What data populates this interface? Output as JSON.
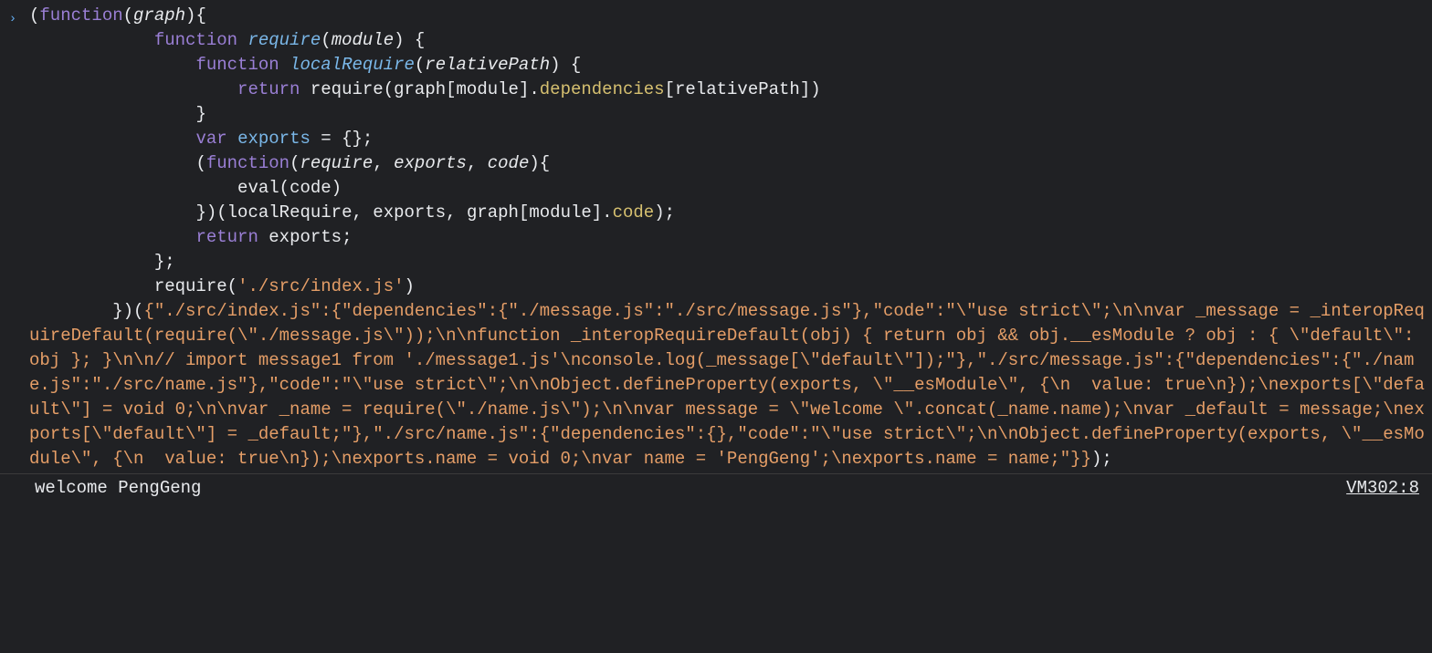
{
  "console": {
    "prompt_glyph": "›",
    "log_output": "welcome PengGeng",
    "source_link": "VM302:8",
    "tokens": [
      {
        "t": "punc",
        "v": "("
      },
      {
        "t": "keyword",
        "v": "function"
      },
      {
        "t": "punc",
        "v": "("
      },
      {
        "t": "param",
        "v": "graph"
      },
      {
        "t": "punc",
        "v": "){"
      },
      {
        "t": "nl",
        "v": "\n"
      },
      {
        "t": "plain",
        "v": "            "
      },
      {
        "t": "keyword",
        "v": "function"
      },
      {
        "t": "plain",
        "v": " "
      },
      {
        "t": "def",
        "v": "require"
      },
      {
        "t": "punc",
        "v": "("
      },
      {
        "t": "param",
        "v": "module"
      },
      {
        "t": "punc",
        "v": ") {"
      },
      {
        "t": "nl",
        "v": "\n"
      },
      {
        "t": "plain",
        "v": "                "
      },
      {
        "t": "keyword",
        "v": "function"
      },
      {
        "t": "plain",
        "v": " "
      },
      {
        "t": "def",
        "v": "localRequire"
      },
      {
        "t": "punc",
        "v": "("
      },
      {
        "t": "param",
        "v": "relativePath"
      },
      {
        "t": "punc",
        "v": ") {"
      },
      {
        "t": "nl",
        "v": "\n"
      },
      {
        "t": "plain",
        "v": "                    "
      },
      {
        "t": "keyword",
        "v": "return"
      },
      {
        "t": "plain",
        "v": " "
      },
      {
        "t": "plain",
        "v": "require"
      },
      {
        "t": "punc",
        "v": "("
      },
      {
        "t": "plain",
        "v": "graph"
      },
      {
        "t": "punc",
        "v": "["
      },
      {
        "t": "plain",
        "v": "module"
      },
      {
        "t": "punc",
        "v": "]."
      },
      {
        "t": "prop",
        "v": "dependencies"
      },
      {
        "t": "punc",
        "v": "["
      },
      {
        "t": "plain",
        "v": "relativePath"
      },
      {
        "t": "punc",
        "v": "])"
      },
      {
        "t": "nl",
        "v": "\n"
      },
      {
        "t": "plain",
        "v": "                "
      },
      {
        "t": "punc",
        "v": "}"
      },
      {
        "t": "nl",
        "v": "\n"
      },
      {
        "t": "plain",
        "v": "                "
      },
      {
        "t": "keyword",
        "v": "var"
      },
      {
        "t": "plain",
        "v": " "
      },
      {
        "t": "def2",
        "v": "exports"
      },
      {
        "t": "plain",
        "v": " "
      },
      {
        "t": "punc",
        "v": "= {};"
      },
      {
        "t": "nl",
        "v": "\n"
      },
      {
        "t": "plain",
        "v": "                "
      },
      {
        "t": "punc",
        "v": "("
      },
      {
        "t": "keyword",
        "v": "function"
      },
      {
        "t": "punc",
        "v": "("
      },
      {
        "t": "param",
        "v": "require"
      },
      {
        "t": "punc",
        "v": ", "
      },
      {
        "t": "param",
        "v": "exports"
      },
      {
        "t": "punc",
        "v": ", "
      },
      {
        "t": "param",
        "v": "code"
      },
      {
        "t": "punc",
        "v": "){"
      },
      {
        "t": "nl",
        "v": "\n"
      },
      {
        "t": "plain",
        "v": "                    "
      },
      {
        "t": "plain",
        "v": "eval"
      },
      {
        "t": "punc",
        "v": "("
      },
      {
        "t": "plain",
        "v": "code"
      },
      {
        "t": "punc",
        "v": ")"
      },
      {
        "t": "nl",
        "v": "\n"
      },
      {
        "t": "plain",
        "v": "                "
      },
      {
        "t": "punc",
        "v": "})("
      },
      {
        "t": "plain",
        "v": "localRequire"
      },
      {
        "t": "punc",
        "v": ", "
      },
      {
        "t": "plain",
        "v": "exports"
      },
      {
        "t": "punc",
        "v": ", "
      },
      {
        "t": "plain",
        "v": "graph"
      },
      {
        "t": "punc",
        "v": "["
      },
      {
        "t": "plain",
        "v": "module"
      },
      {
        "t": "punc",
        "v": "]."
      },
      {
        "t": "prop",
        "v": "code"
      },
      {
        "t": "punc",
        "v": ");"
      },
      {
        "t": "nl",
        "v": "\n"
      },
      {
        "t": "plain",
        "v": "                "
      },
      {
        "t": "keyword",
        "v": "return"
      },
      {
        "t": "plain",
        "v": " "
      },
      {
        "t": "plain",
        "v": "exports"
      },
      {
        "t": "punc",
        "v": ";"
      },
      {
        "t": "nl",
        "v": "\n"
      },
      {
        "t": "plain",
        "v": "            "
      },
      {
        "t": "punc",
        "v": "};"
      },
      {
        "t": "nl",
        "v": "\n"
      },
      {
        "t": "plain",
        "v": "            "
      },
      {
        "t": "plain",
        "v": "require"
      },
      {
        "t": "punc",
        "v": "("
      },
      {
        "t": "string",
        "v": "'./src/index.js'"
      },
      {
        "t": "punc",
        "v": ")"
      },
      {
        "t": "nl",
        "v": "\n"
      },
      {
        "t": "plain",
        "v": "        "
      },
      {
        "t": "punc",
        "v": "})("
      },
      {
        "t": "string",
        "v": "{\"./src/index.js\":{\"dependencies\":{\"./message.js\":\"./src/message.js\"},\"code\":\"\\\"use strict\\\";\\n\\nvar _message = _interopRequireDefault(require(\\\"./message.js\\\"));\\n\\nfunction _interopRequireDefault(obj) { return obj && obj.__esModule ? obj : { \\\"default\\\": obj }; }\\n\\n// import message1 from './message1.js'\\nconsole.log(_message[\\\"default\\\"]);\"},\"./src/message.js\":{\"dependencies\":{\"./name.js\":\"./src/name.js\"},\"code\":\"\\\"use strict\\\";\\n\\nObject.defineProperty(exports, \\\"__esModule\\\", {\\n  value: true\\n});\\nexports[\\\"default\\\"] = void 0;\\n\\nvar _name = require(\\\"./name.js\\\");\\n\\nvar message = \\\"welcome \\\".concat(_name.name);\\nvar _default = message;\\nexports[\\\"default\\\"] = _default;\"},\"./src/name.js\":{\"dependencies\":{},\"code\":\"\\\"use strict\\\";\\n\\nObject.defineProperty(exports, \\\"__esModule\\\", {\\n  value: true\\n});\\nexports.name = void 0;\\nvar name = 'PengGeng';\\nexports.name = name;\"}}"
      },
      {
        "t": "punc",
        "v": ");"
      }
    ]
  }
}
